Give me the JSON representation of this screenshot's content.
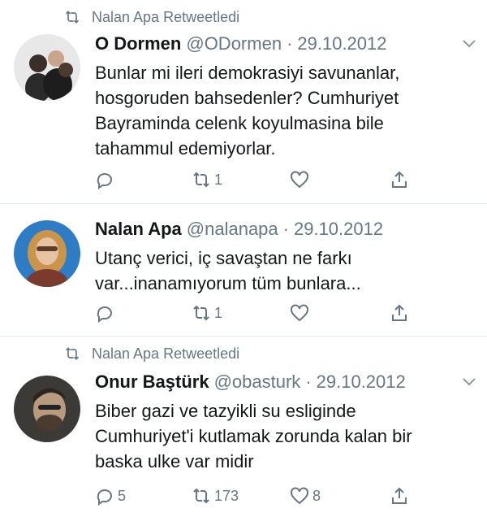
{
  "tweets": [
    {
      "retweet_label": "Nalan Apa Retweetledi",
      "name": "O Dormen",
      "handle": "@ODormen",
      "sep": "·",
      "date": "29.10.2012",
      "text": "Bunlar mi ileri demokrasiyi savunanlar,\nhosgoruden bahsedenler? Cumhuriyet\nBayraminda celenk koyulmasina bile\ntahammul edemiyorlar.",
      "replies": "",
      "retweets": "1",
      "likes": ""
    },
    {
      "retweet_label": "",
      "name": "Nalan Apa",
      "handle": "@nalanapa",
      "sep": "·",
      "date": "29.10.2012",
      "text": "Utanç verici, iç savaştan ne farkı\nvar...inanamıyorum tüm bunlara...",
      "replies": "",
      "retweets": "1",
      "likes": ""
    },
    {
      "retweet_label": "Nalan Apa Retweetledi",
      "name": "Onur Baştürk",
      "handle": "@obasturk",
      "sep": "·",
      "date": "29.10.2012",
      "text": "Biber gazi ve tazyikli su esliginde\nCumhuriyet'i kutlamak zorunda kalan bir\nbaska ulke var midir",
      "replies": "5",
      "retweets": "173",
      "likes": "8"
    }
  ],
  "colors": {
    "text": "#14171a",
    "muted": "#657786",
    "divider": "#e6ecf0"
  },
  "icons": [
    "retweet-icon",
    "reply-icon",
    "like-icon",
    "share-icon",
    "chevron-down-icon"
  ]
}
